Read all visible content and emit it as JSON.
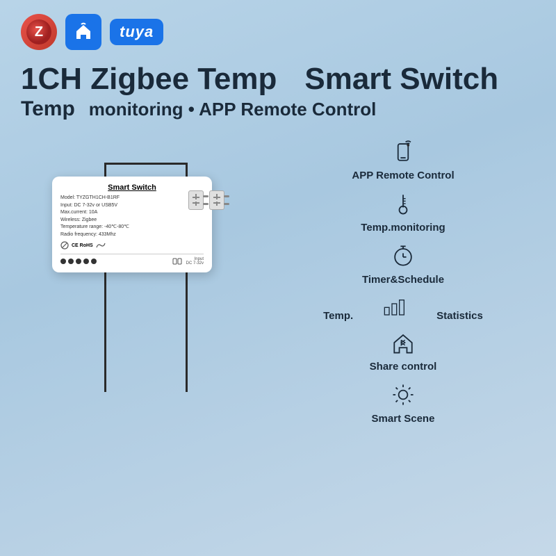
{
  "logos": {
    "zigbee_alt": "Z",
    "home_icon": "🏠",
    "tuya_text": "tuya"
  },
  "title": {
    "line1_left": "1CH Zigbee Temp",
    "line1_right": "Smart Switch",
    "line2_left": "Temp",
    "line2_right": "monitoring • APP Remote Control"
  },
  "device": {
    "name": "Smart Switch",
    "model": "Model: TYZGTH1CH-B1RF",
    "input": "Input: DC 7-32v or USB5V",
    "max_current": "Max.current: 10A",
    "wireless": "Wireless: Zigbee",
    "temp_range": "Temperature range: -40℃-80℃",
    "radio": "Radio frequency: 433Mhz",
    "input_label": "Input\nDC 7-32v"
  },
  "features": [
    {
      "id": "app-remote",
      "label": "APP Remote Control",
      "icon": "phone-signal"
    },
    {
      "id": "temp-monitoring",
      "label": "Temp.monitoring",
      "icon": "thermometer"
    },
    {
      "id": "timer-schedule",
      "label": "Timer&Schedule",
      "icon": "timer"
    },
    {
      "id": "temp-stats",
      "label_left": "Temp.",
      "label_right": "Statistics",
      "icon": "bar-chart"
    },
    {
      "id": "share-control",
      "label": "Share control",
      "icon": "bluetooth-home"
    },
    {
      "id": "smart-scene",
      "label": "Smart Scene",
      "icon": "sun-gear"
    }
  ]
}
